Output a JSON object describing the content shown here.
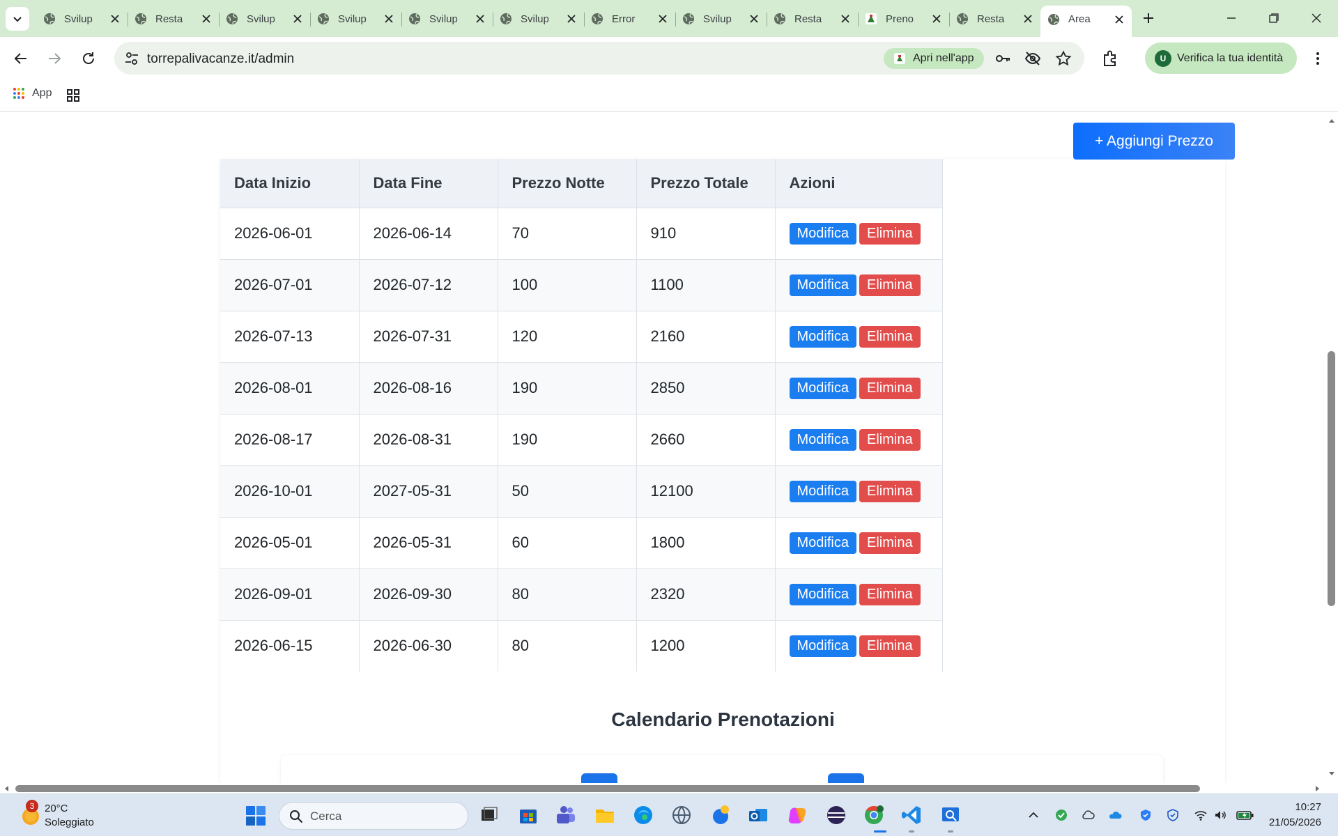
{
  "browser": {
    "tabs": [
      {
        "title": "Svilup",
        "active": false
      },
      {
        "title": "Resta",
        "active": false
      },
      {
        "title": "Svilup",
        "active": false
      },
      {
        "title": "Svilup",
        "active": false
      },
      {
        "title": "Svilup",
        "active": false
      },
      {
        "title": "Svilup",
        "active": false
      },
      {
        "title": "Error",
        "active": false
      },
      {
        "title": "Svilup",
        "active": false
      },
      {
        "title": "Resta",
        "active": false
      },
      {
        "title": "Preno",
        "active": false
      },
      {
        "title": "Resta",
        "active": false
      },
      {
        "title": "Area",
        "active": true
      }
    ],
    "url": "torrepalivacanze.it/admin",
    "open_in_app_label": "Apri nell'app",
    "verify_label": "Verifica la tua identità",
    "avatar_letter": "U",
    "bookmarks": {
      "apps_label": "App"
    }
  },
  "page": {
    "add_price_label": "+ Aggiungi Prezzo",
    "table": {
      "headers": [
        "Data Inizio",
        "Data Fine",
        "Prezzo Notte",
        "Prezzo Totale",
        "Azioni"
      ],
      "edit_label": "Modifica",
      "delete_label": "Elimina",
      "rows": [
        [
          "2026-06-01",
          "2026-06-14",
          "70",
          "910"
        ],
        [
          "2026-07-01",
          "2026-07-12",
          "100",
          "1100"
        ],
        [
          "2026-07-13",
          "2026-07-31",
          "120",
          "2160"
        ],
        [
          "2026-08-01",
          "2026-08-16",
          "190",
          "2850"
        ],
        [
          "2026-08-17",
          "2026-08-31",
          "190",
          "2660"
        ],
        [
          "2026-10-01",
          "2027-05-31",
          "50",
          "12100"
        ],
        [
          "2026-05-01",
          "2026-05-31",
          "60",
          "1800"
        ],
        [
          "2026-09-01",
          "2026-09-30",
          "80",
          "2320"
        ],
        [
          "2026-06-15",
          "2026-06-30",
          "80",
          "1200"
        ]
      ]
    },
    "calendar_title": "Calendario Prenotazioni"
  },
  "taskbar": {
    "weather_badge": "3",
    "weather_temp": "20°C",
    "weather_desc": "Soleggiato",
    "search_placeholder": "Cerca",
    "time": "10:27",
    "date": "21/05/2026"
  },
  "colors": {
    "tabbar_bg": "#d5ecd2",
    "primary_button": "#1a7df0",
    "danger_button": "#e24c4b"
  }
}
